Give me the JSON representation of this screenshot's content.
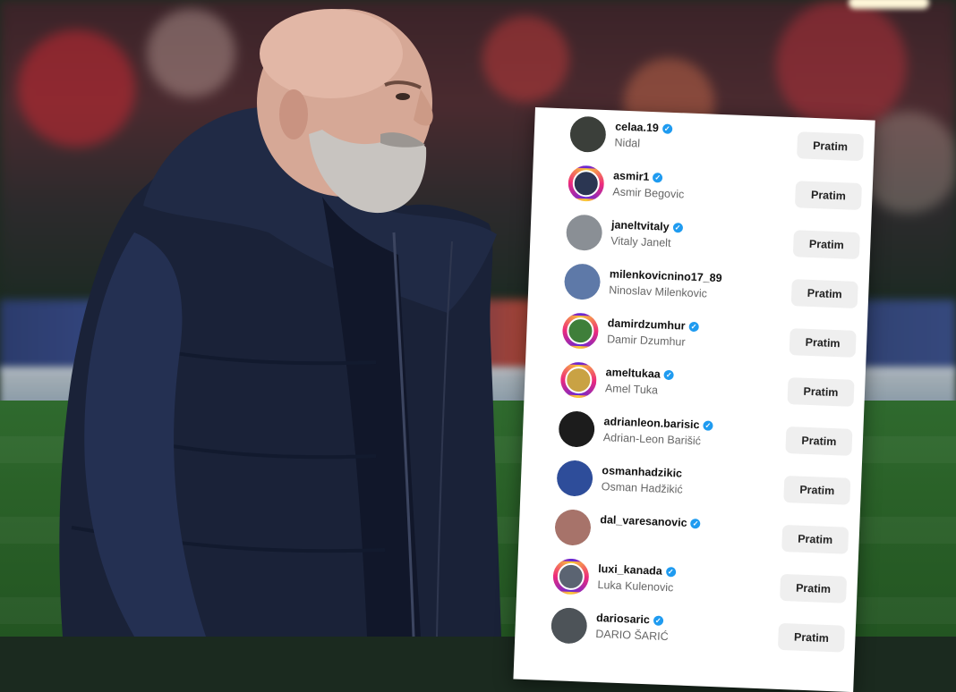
{
  "following_list": {
    "button_label": "Pratim",
    "items": [
      {
        "username": "celaa.19",
        "full_name": "Nidal",
        "verified": true,
        "story_ring": false,
        "avatar_color": "#3b3f3a"
      },
      {
        "username": "asmir1",
        "full_name": "Asmir Begovic",
        "verified": true,
        "story_ring": true,
        "avatar_color": "#2b3652"
      },
      {
        "username": "janeltvitaly",
        "full_name": "Vitaly Janelt",
        "verified": true,
        "story_ring": false,
        "avatar_color": "#8a8f95"
      },
      {
        "username": "milenkovicnino17_89",
        "full_name": "Ninoslav Milenkovic",
        "verified": false,
        "story_ring": false,
        "avatar_color": "#5e79a8"
      },
      {
        "username": "damirdzumhur",
        "full_name": "Damir Dzumhur",
        "verified": true,
        "story_ring": true,
        "avatar_color": "#3f7f3a"
      },
      {
        "username": "ameltukaa",
        "full_name": "Amel Tuka",
        "verified": true,
        "story_ring": true,
        "avatar_color": "#c9a244"
      },
      {
        "username": "adrianleon.barisic",
        "full_name": "Adrian-Leon Barišić",
        "verified": true,
        "story_ring": false,
        "avatar_color": "#1c1c1c"
      },
      {
        "username": "osmanhadzikic",
        "full_name": "Osman Hadžikić",
        "verified": false,
        "story_ring": false,
        "avatar_color": "#2e4d9a"
      },
      {
        "username": "dal_varesanovic",
        "full_name": "",
        "verified": true,
        "story_ring": false,
        "avatar_color": "#a7736a"
      },
      {
        "username": "luxi_kanada",
        "full_name": "Luka Kulenovic",
        "verified": true,
        "story_ring": true,
        "avatar_color": "#5b6472"
      },
      {
        "username": "dariosaric",
        "full_name": "DARIO ŠARIĆ",
        "verified": true,
        "story_ring": false,
        "avatar_color": "#4d5358"
      }
    ]
  },
  "colors": {
    "verified_badge": "#1f9bf0",
    "button_bg": "#efefef",
    "card_bg": "#ffffff"
  }
}
